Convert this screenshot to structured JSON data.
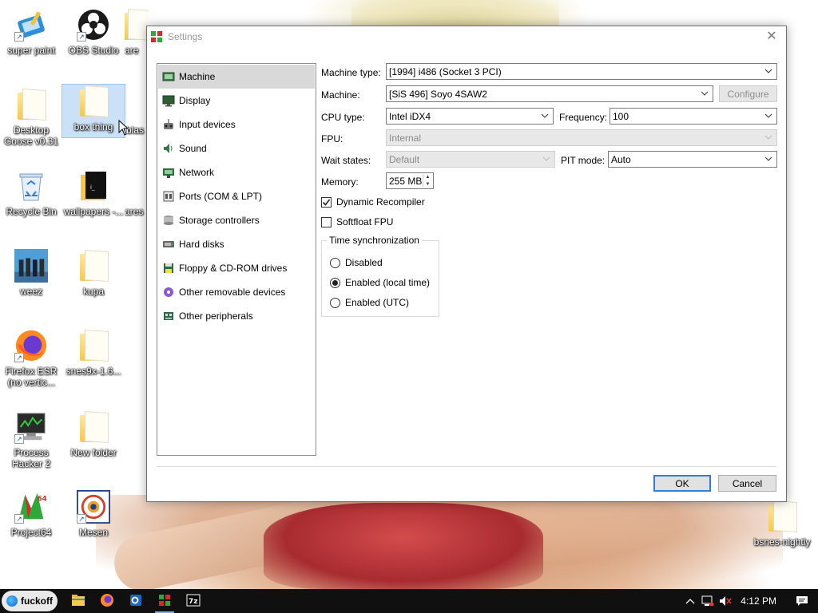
{
  "desktop": {
    "icons": [
      {
        "label": "super paint"
      },
      {
        "label": "OBS Studio"
      },
      {
        "label": "Desktop\nGoose v0.31"
      },
      {
        "label": "box thing"
      },
      {
        "label": "Recycle Bin"
      },
      {
        "label": "wallpapers -..."
      },
      {
        "label": "weez"
      },
      {
        "label": "kupa"
      },
      {
        "label": "Firefox ESR\n(no vertic..."
      },
      {
        "label": "snes9x-1.6..."
      },
      {
        "label": "Process\nHacker 2"
      },
      {
        "label": "New folder"
      },
      {
        "label": "Project64"
      },
      {
        "label": "Mesen"
      },
      {
        "label": "bsnes-nightly"
      },
      {
        "label": "are"
      },
      {
        "label": "blas"
      },
      {
        "label": "ares"
      }
    ]
  },
  "dialog": {
    "title": "Settings",
    "close_glyph": "✕",
    "nav": [
      {
        "label": "Machine"
      },
      {
        "label": "Display"
      },
      {
        "label": "Input devices"
      },
      {
        "label": "Sound"
      },
      {
        "label": "Network"
      },
      {
        "label": "Ports (COM & LPT)"
      },
      {
        "label": "Storage controllers"
      },
      {
        "label": "Hard disks"
      },
      {
        "label": "Floppy & CD-ROM drives"
      },
      {
        "label": "Other removable devices"
      },
      {
        "label": "Other peripherals"
      }
    ],
    "form": {
      "machine_type_label": "Machine type:",
      "machine_type_value": "[1994] i486 (Socket 3 PCI)",
      "machine_label": "Machine:",
      "machine_value": "[SiS 496] Soyo 4SAW2",
      "configure_label": "Configure",
      "cpu_type_label": "CPU type:",
      "cpu_type_value": "Intel iDX4",
      "frequency_label": "Frequency:",
      "frequency_value": "100",
      "fpu_label": "FPU:",
      "fpu_value": "Internal",
      "wait_states_label": "Wait states:",
      "wait_states_value": "Default",
      "pit_mode_label": "PIT mode:",
      "pit_mode_value": "Auto",
      "memory_label": "Memory:",
      "memory_value": "255 MB",
      "dynamic_recompiler_label": "Dynamic Recompiler",
      "dynamic_recompiler_checked": true,
      "softfloat_label": "Softfloat FPU",
      "softfloat_checked": false,
      "time_sync_title": "Time synchronization",
      "time_sync_options": [
        {
          "label": "Disabled",
          "selected": false
        },
        {
          "label": "Enabled (local time)",
          "selected": true
        },
        {
          "label": "Enabled (UTC)",
          "selected": false
        }
      ]
    },
    "buttons": {
      "ok": "OK",
      "cancel": "Cancel"
    }
  },
  "taskbar": {
    "start_label": "fuckoff",
    "clock": "4:12 PM"
  }
}
